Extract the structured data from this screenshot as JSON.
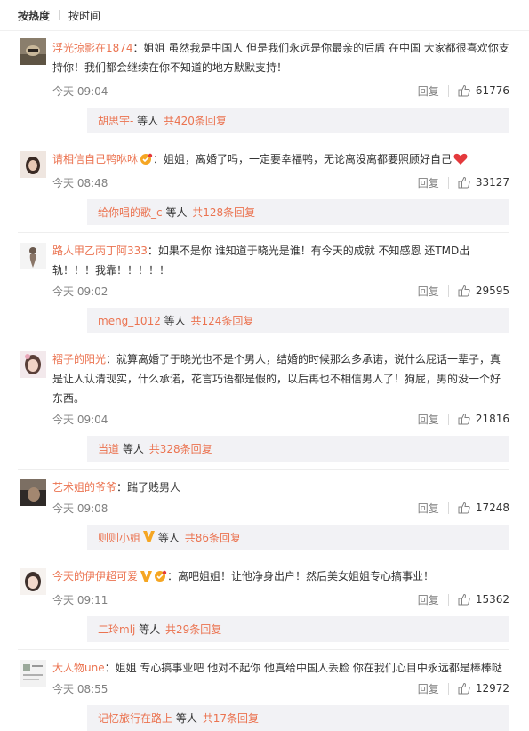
{
  "sort": {
    "hot": "按热度",
    "time": "按时间"
  },
  "reply_label": "回复",
  "reply_suffix_prefix": "等人",
  "comments": [
    {
      "user": "浮光掠影在1874",
      "text": "：姐姐 虽然我是中国人 但是我们永远是你最亲的后盾 在中国 大家都很喜欢你支持你！我们都会继续在你不知道的地方默默支持！",
      "time": "今天 09:04",
      "likes": "61776",
      "replies_user": "胡思宇-",
      "replies_tail": "等人",
      "replies_count": "共420条回复"
    },
    {
      "user": "请相信自己鸭咻咻",
      "text": "：姐姐，离婚了吗，一定要幸福鸭，无论离没离都要照顾好自己",
      "time": "今天 08:48",
      "likes": "33127",
      "replies_user": "给你唱的歌_c",
      "replies_tail": "等人",
      "replies_count": "共128条回复"
    },
    {
      "user": "路人甲乙丙丁阿333",
      "text": "：如果不是你 谁知道于晓光是谁！有今天的成就 不知感恩 还TMD出轨！！！我靠！！！！！",
      "time": "今天 09:02",
      "likes": "29595",
      "replies_user": "meng_1012",
      "replies_tail": "等人",
      "replies_count": "共124条回复"
    },
    {
      "user": "褶子的阳光",
      "text": "：就算离婚了于晓光也不是个男人，结婚的时候那么多承诺，说什么屁话一辈子，真是让人认清现实，什么承诺，花言巧语都是假的，以后再也不相信男人了！狗屁，男的没一个好东西。",
      "time": "今天 09:04",
      "likes": "21816",
      "replies_user": "当道 ",
      "replies_tail": "等人",
      "replies_count": "共328条回复"
    },
    {
      "user": "艺术姐的爷爷",
      "text": "：踹了贱男人",
      "time": "今天 09:08",
      "likes": "17248",
      "replies_user": "则则小姐",
      "replies_tail": "等人",
      "replies_count": "共86条回复"
    },
    {
      "user": "今天的伊伊超可爱",
      "text": "：离吧姐姐！让他净身出户！然后美女姐姐专心搞事业！",
      "time": "今天 09:11",
      "likes": "15362",
      "replies_user": "二玲mlj",
      "replies_tail": "等人",
      "replies_count": "共29条回复"
    },
    {
      "user": "大人物une",
      "text": "：姐姐 专心搞事业吧  他对不起你  他真给中国人丢脸  你在我们心目中永远都是棒棒哒",
      "time": "今天 08:55",
      "likes": "12972",
      "replies_user": "记忆旅行在路上",
      "replies_tail": "等人",
      "replies_count": "共17条回复"
    }
  ],
  "colors": {
    "username": "#eb7350",
    "reply_bg": "#f2f2f5",
    "heart": "#e4393c",
    "vip": "#f5a623"
  }
}
